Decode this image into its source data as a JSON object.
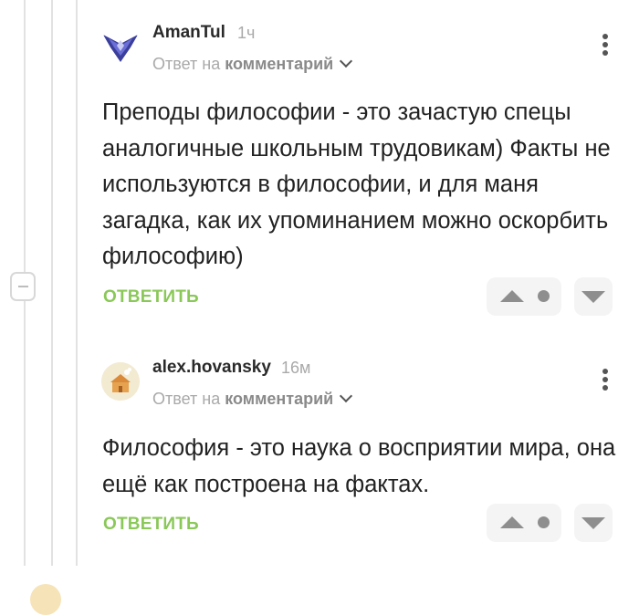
{
  "comments": [
    {
      "author": "AmanTul",
      "time": "1ч",
      "reply_prefix": "Ответ на",
      "reply_target": "комментарий",
      "text": "Преподы философии - это зачастую спецы аналогичные школьным трудовикам) Факты не используются в философии, и для маня загадка, как их упоминанием можно оскорбить философию)",
      "reply_label": "ОТВЕТИТЬ",
      "avatar_icon": "winged-emblem-icon"
    },
    {
      "author": "alex.hovansky",
      "time": "16м",
      "reply_prefix": "Ответ на",
      "reply_target": "комментарий",
      "text": "Философия - это наука о восприятии мира, она ещё как построена на фактах.",
      "reply_label": "ОТВЕТИТЬ",
      "avatar_icon": "cartoon-house-icon"
    }
  ],
  "colors": {
    "reply_accent": "#8ac858",
    "thread_line": "#e2e2e2",
    "muted_text": "#a9a9a9"
  }
}
